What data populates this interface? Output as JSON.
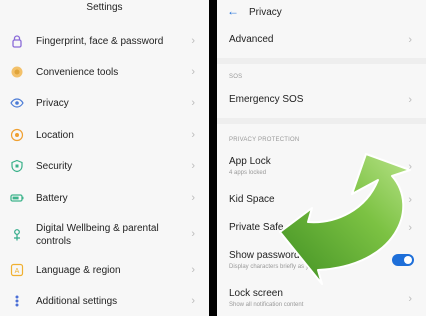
{
  "left": {
    "title": "Settings",
    "items": [
      {
        "label": "Fingerprint, face & password",
        "icon": "lock-icon",
        "color": "#8a6bd8"
      },
      {
        "label": "Convenience tools",
        "icon": "hand-icon",
        "color": "#e0a43a"
      },
      {
        "label": "Privacy",
        "icon": "eye-icon",
        "color": "#4b7bd6"
      },
      {
        "label": "Location",
        "icon": "location-icon",
        "color": "#f0a030"
      },
      {
        "label": "Security",
        "icon": "shield-icon",
        "color": "#38b088"
      },
      {
        "label": "Battery",
        "icon": "battery-icon",
        "color": "#3fb48c"
      },
      {
        "label": "Digital Wellbeing & parental controls",
        "icon": "wellbeing-icon",
        "color": "#2faa88"
      },
      {
        "label": "Language & region",
        "icon": "language-icon",
        "color": "#f0b030"
      },
      {
        "label": "Additional settings",
        "icon": "dots-icon",
        "color": "#4b6fd6"
      }
    ]
  },
  "right": {
    "title": "Privacy",
    "advanced": "Advanced",
    "sos_section": "SOS",
    "emergency_sos": "Emergency SOS",
    "privacy_section": "PRIVACY PROTECTION",
    "app_lock": "App Lock",
    "app_lock_sub": "4 apps locked",
    "kid_space": "Kid Space",
    "private_safe": "Private Safe",
    "show_password": "Show password",
    "show_password_sub": "Display characters briefly as you type",
    "show_password_on": true,
    "lock_screen": "Lock screen",
    "lock_screen_sub": "Show all notification content"
  },
  "colors": {
    "accent": "#1e6fd9",
    "arrow": "#6bb33c"
  }
}
